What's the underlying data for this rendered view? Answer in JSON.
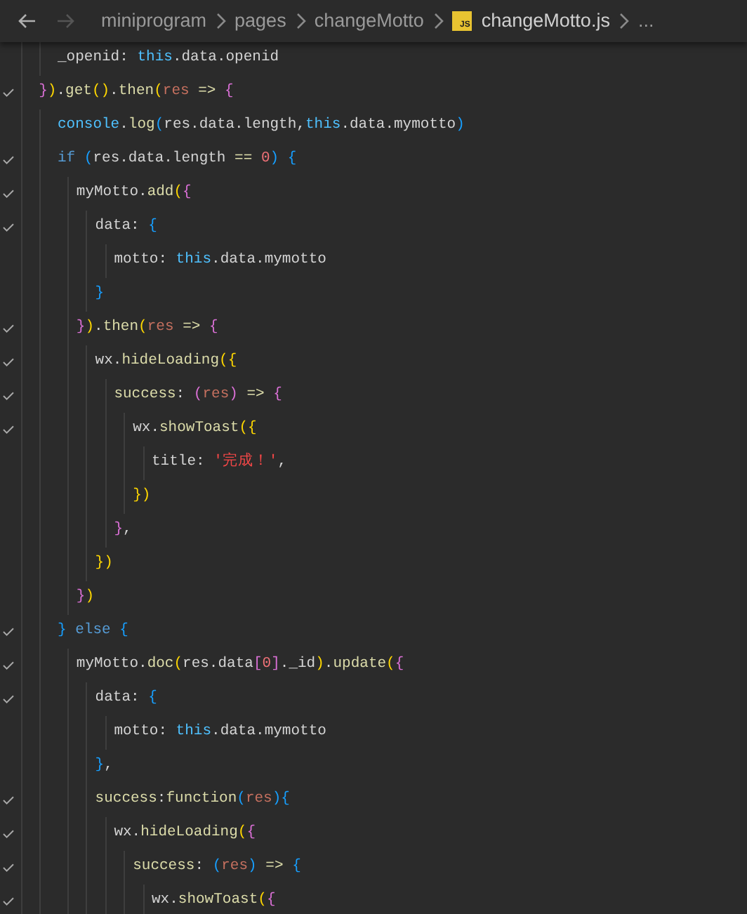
{
  "breadcrumb": {
    "items": [
      {
        "kind": "folder",
        "label": "miniprogram"
      },
      {
        "kind": "folder",
        "label": "pages"
      },
      {
        "kind": "folder",
        "label": "changeMotto"
      },
      {
        "kind": "file",
        "badge": "JS",
        "label": "changeMotto.js"
      }
    ],
    "more": "..."
  },
  "lines": [
    {
      "children": [
        {
          "check": false,
          "tokens": [
            {
              "t": "_openid: ",
              "color": "#d4d4d4"
            },
            {
              "t": "this",
              "color": "#4fc1ff"
            },
            {
              "t": ".data.openid",
              "color": "#d4d4d4"
            }
          ]
        }
      ]
    },
    {
      "check": true,
      "tokens": [
        {
          "t": "}",
          "color": "#da70d6"
        },
        {
          "t": ")",
          "color": "#ffd700"
        },
        {
          "t": ".",
          "color": "#d4d4d4"
        },
        {
          "t": "get",
          "color": "#dcdcaa"
        },
        {
          "t": "()",
          "color": "#ffd700"
        },
        {
          "t": ".",
          "color": "#d4d4d4"
        },
        {
          "t": "then",
          "color": "#dcdcaa"
        },
        {
          "t": "(",
          "color": "#ffd700"
        },
        {
          "t": "res",
          "color": "#c5705f"
        },
        {
          "t": " => ",
          "color": "#dcdcaa"
        },
        {
          "t": "{",
          "color": "#da70d6"
        }
      ],
      "children": [
        {
          "check": false,
          "tokens": [
            {
              "t": "console",
              "color": "#4fc1ff"
            },
            {
              "t": ".",
              "color": "#d4d4d4"
            },
            {
              "t": "log",
              "color": "#dcdcaa"
            },
            {
              "t": "(",
              "color": "#179fff"
            },
            {
              "t": "res.data.length,",
              "color": "#d4d4d4"
            },
            {
              "t": "this",
              "color": "#4fc1ff"
            },
            {
              "t": ".data.mymotto",
              "color": "#d4d4d4"
            },
            {
              "t": ")",
              "color": "#179fff"
            }
          ]
        },
        {
          "check": true,
          "tokens": [
            {
              "t": "if ",
              "color": "#569cd6"
            },
            {
              "t": "(",
              "color": "#179fff"
            },
            {
              "t": "res.data.length ",
              "color": "#d4d4d4"
            },
            {
              "t": "== ",
              "color": "#dcdcaa"
            },
            {
              "t": "0",
              "color": "#f07178"
            },
            {
              "t": ") {",
              "color": "#179fff"
            }
          ],
          "children": [
            {
              "check": true,
              "tokens": [
                {
                  "t": "myMotto.",
                  "color": "#d4d4d4"
                },
                {
                  "t": "add",
                  "color": "#dcdcaa"
                },
                {
                  "t": "(",
                  "color": "#ffd700"
                },
                {
                  "t": "{",
                  "color": "#da70d6"
                }
              ],
              "children": [
                {
                  "check": true,
                  "tokens": [
                    {
                      "t": "data: ",
                      "color": "#d4d4d4"
                    },
                    {
                      "t": "{",
                      "color": "#179fff"
                    }
                  ],
                  "children": [
                    {
                      "check": false,
                      "tokens": [
                        {
                          "t": "motto: ",
                          "color": "#d4d4d4"
                        },
                        {
                          "t": "this",
                          "color": "#4fc1ff"
                        },
                        {
                          "t": ".data.mymotto",
                          "color": "#d4d4d4"
                        }
                      ]
                    }
                  ]
                },
                {
                  "check": false,
                  "tokens": [
                    {
                      "t": "}",
                      "color": "#179fff"
                    }
                  ]
                }
              ]
            },
            {
              "check": true,
              "tokens": [
                {
                  "t": "}",
                  "color": "#da70d6"
                },
                {
                  "t": ")",
                  "color": "#ffd700"
                },
                {
                  "t": ".",
                  "color": "#d4d4d4"
                },
                {
                  "t": "then",
                  "color": "#dcdcaa"
                },
                {
                  "t": "(",
                  "color": "#ffd700"
                },
                {
                  "t": "res",
                  "color": "#c5705f"
                },
                {
                  "t": " => ",
                  "color": "#dcdcaa"
                },
                {
                  "t": "{",
                  "color": "#da70d6"
                }
              ],
              "children": [
                {
                  "check": true,
                  "tokens": [
                    {
                      "t": "wx.",
                      "color": "#d4d4d4"
                    },
                    {
                      "t": "hideLoading",
                      "color": "#dcdcaa"
                    },
                    {
                      "t": "({",
                      "color": "#ffd700"
                    }
                  ],
                  "children": [
                    {
                      "check": true,
                      "tokens": [
                        {
                          "t": "success",
                          "color": "#dcdcaa"
                        },
                        {
                          "t": ": ",
                          "color": "#d4d4d4"
                        },
                        {
                          "t": "(",
                          "color": "#da70d6"
                        },
                        {
                          "t": "res",
                          "color": "#c5705f"
                        },
                        {
                          "t": ")",
                          "color": "#da70d6"
                        },
                        {
                          "t": " => ",
                          "color": "#dcdcaa"
                        },
                        {
                          "t": "{",
                          "color": "#da70d6"
                        }
                      ],
                      "children": [
                        {
                          "check": true,
                          "tokens": [
                            {
                              "t": "wx.",
                              "color": "#d4d4d4"
                            },
                            {
                              "t": "showToast",
                              "color": "#dcdcaa"
                            },
                            {
                              "t": "({",
                              "color": "#ffd700"
                            }
                          ],
                          "children": [
                            {
                              "check": false,
                              "tokens": [
                                {
                                  "t": "title: ",
                                  "color": "#d4d4d4"
                                },
                                {
                                  "t": "'完成！'",
                                  "color": "#f44747"
                                },
                                {
                                  "t": ",",
                                  "color": "#d4d4d4"
                                }
                              ]
                            }
                          ]
                        },
                        {
                          "check": false,
                          "tokens": [
                            {
                              "t": "})",
                              "color": "#ffd700"
                            }
                          ]
                        }
                      ]
                    },
                    {
                      "check": false,
                      "tokens": [
                        {
                          "t": "}",
                          "color": "#da70d6"
                        },
                        {
                          "t": ",",
                          "color": "#d4d4d4"
                        }
                      ]
                    }
                  ]
                },
                {
                  "check": false,
                  "tokens": [
                    {
                      "t": "})",
                      "color": "#ffd700"
                    }
                  ]
                }
              ]
            },
            {
              "check": false,
              "tokens": [
                {
                  "t": "}",
                  "color": "#da70d6"
                },
                {
                  "t": ")",
                  "color": "#ffd700"
                }
              ]
            }
          ]
        },
        {
          "check": true,
          "tokens": [
            {
              "t": "} ",
              "color": "#179fff"
            },
            {
              "t": "else ",
              "color": "#569cd6"
            },
            {
              "t": "{",
              "color": "#179fff"
            }
          ],
          "children": [
            {
              "check": true,
              "tokens": [
                {
                  "t": "myMotto.",
                  "color": "#d4d4d4"
                },
                {
                  "t": "doc",
                  "color": "#dcdcaa"
                },
                {
                  "t": "(",
                  "color": "#ffd700"
                },
                {
                  "t": "res.data",
                  "color": "#d4d4d4"
                },
                {
                  "t": "[",
                  "color": "#da70d6"
                },
                {
                  "t": "0",
                  "color": "#f07178"
                },
                {
                  "t": "]",
                  "color": "#da70d6"
                },
                {
                  "t": "._id",
                  "color": "#d4d4d4"
                },
                {
                  "t": ")",
                  "color": "#ffd700"
                },
                {
                  "t": ".",
                  "color": "#d4d4d4"
                },
                {
                  "t": "update",
                  "color": "#dcdcaa"
                },
                {
                  "t": "(",
                  "color": "#ffd700"
                },
                {
                  "t": "{",
                  "color": "#da70d6"
                }
              ],
              "children": [
                {
                  "check": true,
                  "tokens": [
                    {
                      "t": "data: ",
                      "color": "#d4d4d4"
                    },
                    {
                      "t": "{",
                      "color": "#179fff"
                    }
                  ],
                  "children": [
                    {
                      "check": false,
                      "tokens": [
                        {
                          "t": "motto: ",
                          "color": "#d4d4d4"
                        },
                        {
                          "t": "this",
                          "color": "#4fc1ff"
                        },
                        {
                          "t": ".data.mymotto",
                          "color": "#d4d4d4"
                        }
                      ]
                    }
                  ]
                },
                {
                  "check": false,
                  "tokens": [
                    {
                      "t": "}",
                      "color": "#179fff"
                    },
                    {
                      "t": ",",
                      "color": "#d4d4d4"
                    }
                  ]
                },
                {
                  "check": true,
                  "tokens": [
                    {
                      "t": "success",
                      "color": "#dcdcaa"
                    },
                    {
                      "t": ":",
                      "color": "#d4d4d4"
                    },
                    {
                      "t": "function",
                      "color": "#dcdcaa"
                    },
                    {
                      "t": "(",
                      "color": "#179fff"
                    },
                    {
                      "t": "res",
                      "color": "#c5705f"
                    },
                    {
                      "t": "){",
                      "color": "#179fff"
                    }
                  ],
                  "children": [
                    {
                      "check": true,
                      "tokens": [
                        {
                          "t": "wx.",
                          "color": "#d4d4d4"
                        },
                        {
                          "t": "hideLoading",
                          "color": "#dcdcaa"
                        },
                        {
                          "t": "(",
                          "color": "#ffd700"
                        },
                        {
                          "t": "{",
                          "color": "#da70d6"
                        }
                      ],
                      "children": [
                        {
                          "check": true,
                          "tokens": [
                            {
                              "t": "success",
                              "color": "#dcdcaa"
                            },
                            {
                              "t": ": ",
                              "color": "#d4d4d4"
                            },
                            {
                              "t": "(",
                              "color": "#179fff"
                            },
                            {
                              "t": "res",
                              "color": "#c5705f"
                            },
                            {
                              "t": ")",
                              "color": "#179fff"
                            },
                            {
                              "t": " => ",
                              "color": "#dcdcaa"
                            },
                            {
                              "t": "{",
                              "color": "#179fff"
                            }
                          ],
                          "children": [
                            {
                              "check": true,
                              "tokens": [
                                {
                                  "t": "wx.",
                                  "color": "#d4d4d4"
                                },
                                {
                                  "t": "showToast",
                                  "color": "#dcdcaa"
                                },
                                {
                                  "t": "(",
                                  "color": "#ffd700"
                                },
                                {
                                  "t": "{",
                                  "color": "#da70d6"
                                }
                              ]
                            }
                          ]
                        }
                      ]
                    }
                  ]
                }
              ]
            }
          ]
        }
      ]
    }
  ]
}
